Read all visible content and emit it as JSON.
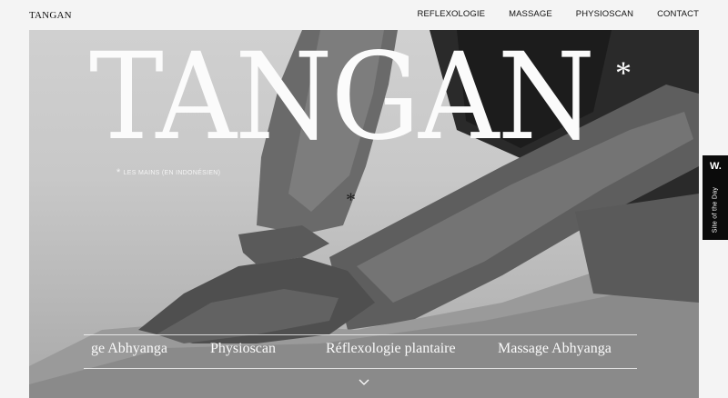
{
  "header": {
    "logo": "TANGAN",
    "nav": [
      "REFLEXOLOGIE",
      "MASSAGE",
      "PHYSIOSCAN",
      "CONTACT"
    ]
  },
  "hero": {
    "title": "TANGAN",
    "title_mark": "*",
    "footnote_mark": "*",
    "footnote": "LES MAINS (EN INDONÉSIEN)",
    "inline_mark": "*",
    "marquee": [
      "ge Abhyanga",
      "Physioscan",
      "Réflexologie plantaire",
      "Massage Abhyanga"
    ],
    "scroll_icon": "chevron-down-icon"
  },
  "badge": {
    "letter": "W.",
    "label": "Site of the Day"
  },
  "colors": {
    "background": "#f4f4f4",
    "title": "#fbfbfb",
    "badge": "#0b0b0b"
  }
}
